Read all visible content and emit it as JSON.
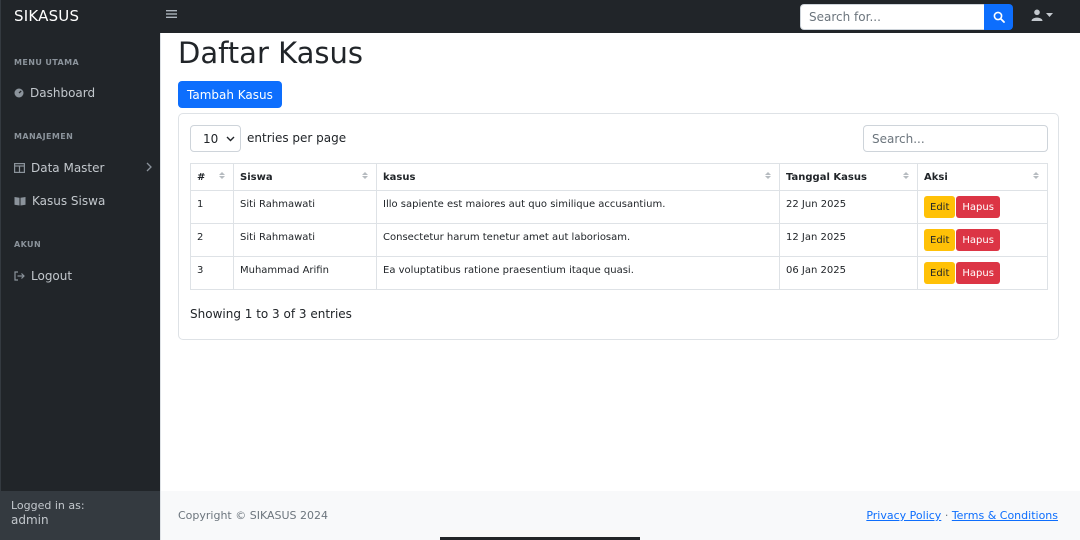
{
  "navbar": {
    "brand": "SIKASUS",
    "search_placeholder": "Search for...",
    "icons": {
      "menu": "hamburger-icon",
      "search": "search-icon",
      "user": "user-icon"
    }
  },
  "sidebar": {
    "headings": [
      "MENU UTAMA",
      "MANAJEMEN",
      "AKUN"
    ],
    "items": [
      {
        "label": "Dashboard",
        "icon": "dashboard-icon"
      },
      {
        "label": "Data Master",
        "icon": "columns-icon"
      },
      {
        "label": "Kasus Siswa",
        "icon": "book-icon"
      },
      {
        "label": "Logout",
        "icon": "logout-icon"
      }
    ],
    "footer": {
      "logged_in_label": "Logged in as:",
      "username": "admin"
    }
  },
  "main": {
    "title": "Daftar Kasus",
    "add_button": "Tambah Kasus",
    "per_page_value": "10",
    "per_page_label": "entries per page",
    "search_placeholder": "Search...",
    "columns": [
      "#",
      "Siswa",
      "kasus",
      "Tanggal Kasus",
      "Aksi"
    ],
    "rows": [
      {
        "no": "1",
        "siswa": "Siti Rahmawati",
        "kasus": "Illo sapiente est maiores aut quo similique accusantium.",
        "tanggal": "22 Jun 2025"
      },
      {
        "no": "2",
        "siswa": "Siti Rahmawati",
        "kasus": "Consectetur harum tenetur amet aut laboriosam.",
        "tanggal": "12 Jan 2025"
      },
      {
        "no": "3",
        "siswa": "Muhammad Arifin",
        "kasus": "Ea voluptatibus ratione praesentium itaque quasi.",
        "tanggal": "06 Jan 2025"
      }
    ],
    "edit_label": "Edit",
    "delete_label": "Hapus",
    "showing": "Showing 1 to 3 of 3 entries"
  },
  "footer": {
    "copyright": "Copyright © SIKASUS 2024",
    "privacy": "Privacy Policy",
    "separator": "·",
    "terms": "Terms & Conditions"
  },
  "colors": {
    "primary": "#0d6efd",
    "warning": "#ffc107",
    "danger": "#dc3545",
    "dark": "#212529"
  }
}
